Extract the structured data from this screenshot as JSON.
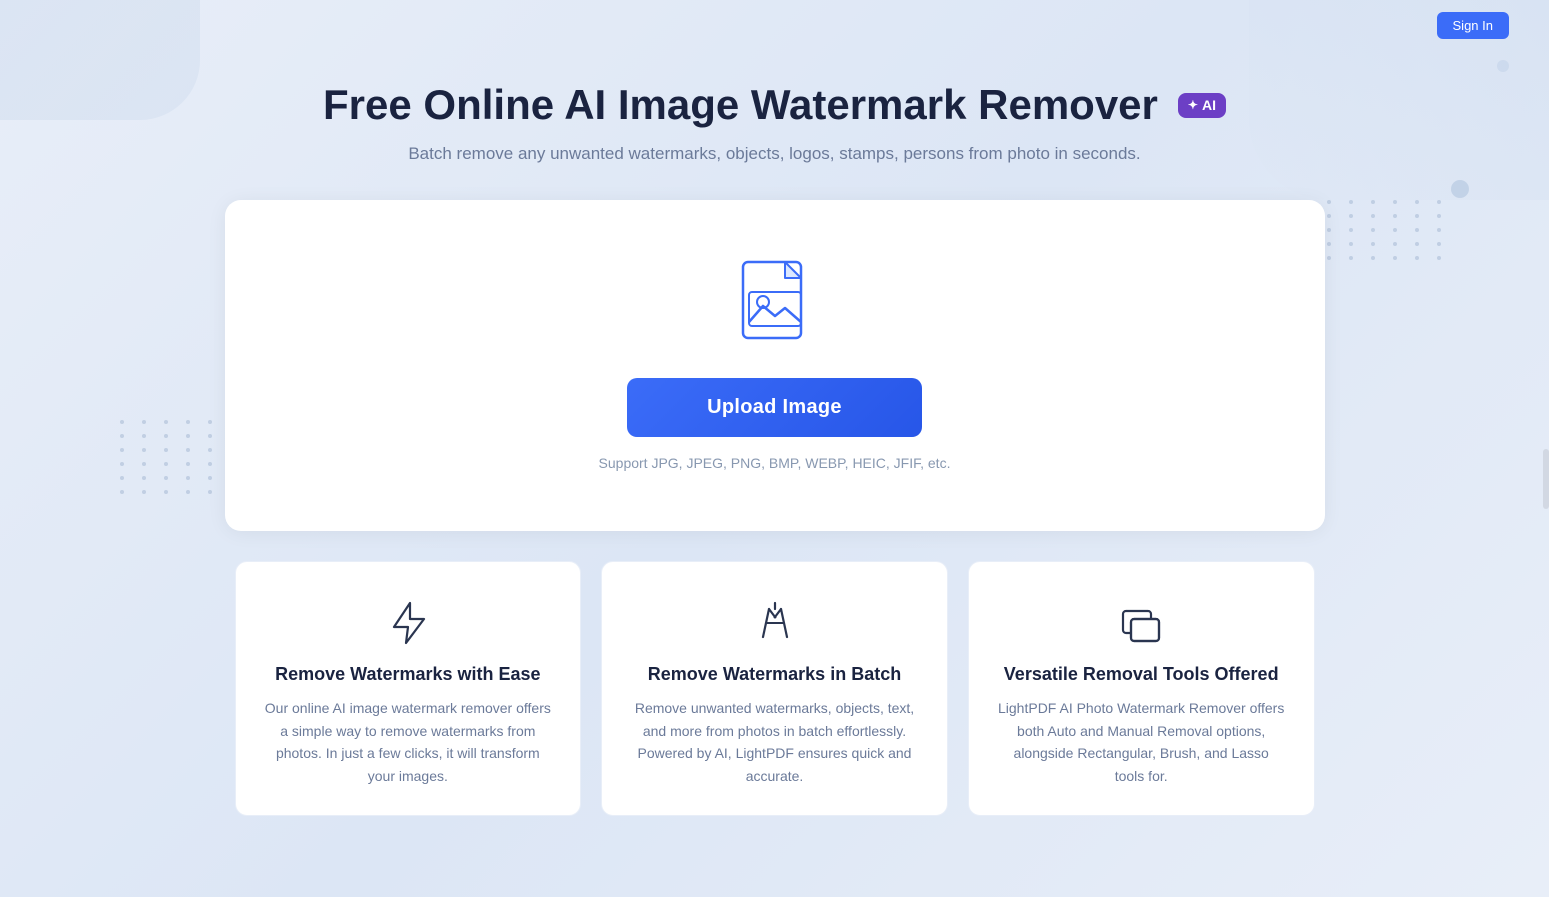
{
  "header": {
    "btn_label": "Sign In"
  },
  "hero": {
    "title": "Free Online AI Image Watermark Remover",
    "ai_badge": "AI",
    "subtitle": "Batch remove any unwanted watermarks, objects, logos, stamps, persons from photo in seconds."
  },
  "upload": {
    "btn_label": "Upload Image",
    "support_text": "Support JPG, JPEG, PNG, BMP, WEBP, HEIC, JFIF, etc."
  },
  "features": [
    {
      "title": "Remove Watermarks with Ease",
      "desc": "Our online AI image watermark remover offers a simple way to remove watermarks from photos. In just a few clicks, it will transform your images.",
      "icon": "lightning"
    },
    {
      "title": "Remove Watermarks in Batch",
      "desc": "Remove unwanted watermarks, objects, text, and more from photos in batch effortlessly. Powered by AI, LightPDF ensures quick and accurate.",
      "icon": "target"
    },
    {
      "title": "Versatile Removal Tools Offered",
      "desc": "LightPDF AI Photo Watermark Remover offers both Auto and Manual Removal options, alongside Rectangular, Brush, and Lasso tools for.",
      "icon": "layers"
    }
  ],
  "dots": {
    "count": 42
  }
}
